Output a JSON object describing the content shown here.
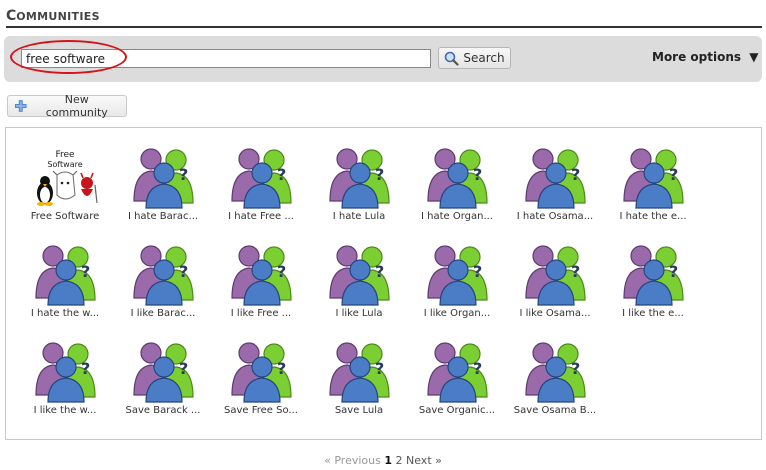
{
  "header": {
    "title_cap": "C",
    "title_rest": "OMMUNITIES"
  },
  "search": {
    "value": "free software",
    "button_label": "Search"
  },
  "more_options": {
    "label": "More options",
    "arrow": "▼"
  },
  "new_community": {
    "label": "New community"
  },
  "communities": [
    {
      "label": "Free Software",
      "icon": "free-software-logo"
    },
    {
      "label": "I hate Barac...",
      "icon": "community-icon"
    },
    {
      "label": "I hate Free ...",
      "icon": "community-icon"
    },
    {
      "label": "I hate Lula",
      "icon": "community-icon"
    },
    {
      "label": "I hate Organ...",
      "icon": "community-icon"
    },
    {
      "label": "I hate Osama...",
      "icon": "community-icon"
    },
    {
      "label": "I hate the e...",
      "icon": "community-icon"
    },
    {
      "label": "I hate the w...",
      "icon": "community-icon"
    },
    {
      "label": "I like Barac...",
      "icon": "community-icon"
    },
    {
      "label": "I like Free ...",
      "icon": "community-icon"
    },
    {
      "label": "I like Lula",
      "icon": "community-icon"
    },
    {
      "label": "I like Organ...",
      "icon": "community-icon"
    },
    {
      "label": "I like Osama...",
      "icon": "community-icon"
    },
    {
      "label": "I like the e...",
      "icon": "community-icon"
    },
    {
      "label": "I like the w...",
      "icon": "community-icon"
    },
    {
      "label": "Save Barack ...",
      "icon": "community-icon"
    },
    {
      "label": "Save Free So...",
      "icon": "community-icon"
    },
    {
      "label": "Save Lula",
      "icon": "community-icon"
    },
    {
      "label": "Save Organic...",
      "icon": "community-icon"
    },
    {
      "label": "Save Osama B...",
      "icon": "community-icon"
    }
  ],
  "logo_text": {
    "line1": "Free",
    "line2": "Software"
  },
  "pagination": {
    "previous": "« Previous",
    "current": "1",
    "page2": "2",
    "next": "Next »"
  },
  "colors": {
    "purple": "#8a5a9c",
    "green": "#6fbf2a",
    "blue": "#3f6bb5",
    "accent_red": "#d4141a"
  }
}
